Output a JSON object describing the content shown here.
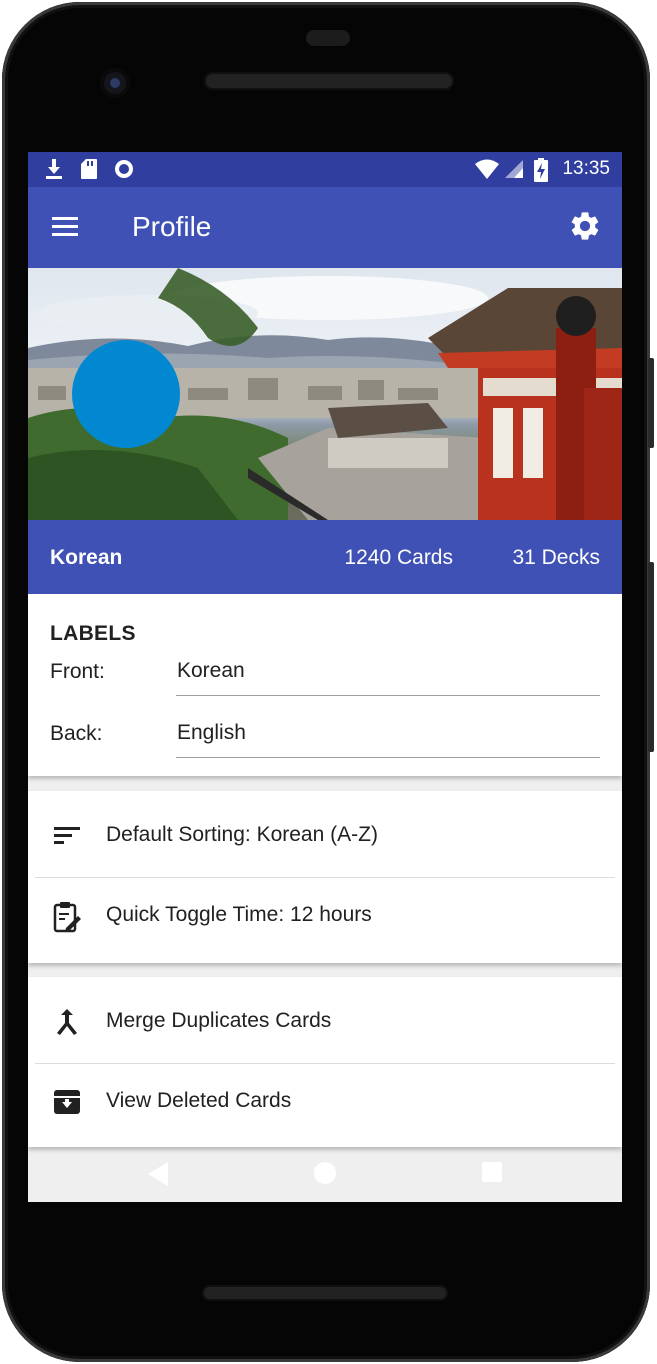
{
  "status_bar": {
    "time": "13:35",
    "left_icons": [
      "download-icon",
      "sd-card-icon",
      "record-icon"
    ],
    "right_icons": [
      "wifi-icon",
      "signal-icon",
      "battery-charging-icon"
    ]
  },
  "app_bar": {
    "title": "Profile",
    "menu_icon": "hamburger-menu-icon",
    "settings_icon": "gear-icon"
  },
  "profile": {
    "name": "Korean",
    "cards": "1240 Cards",
    "decks": "31 Decks",
    "avatar_color": "#0288d1"
  },
  "labels": {
    "heading": "LABELS",
    "front_label": "Front:",
    "front_value": "Korean",
    "back_label": "Back:",
    "back_value": "English"
  },
  "settings_list": [
    {
      "icon": "sort-icon",
      "label": "Default Sorting: Korean (A-Z)"
    },
    {
      "icon": "clipboard-edit-icon",
      "label": "Quick Toggle Time: 12 hours"
    }
  ],
  "tools_list": [
    {
      "icon": "merge-icon",
      "label": "Merge Duplicates Cards"
    },
    {
      "icon": "archive-icon",
      "label": "View Deleted Cards"
    }
  ],
  "nav_bar": [
    "back-triangle-icon",
    "home-circle-icon",
    "recents-square-icon"
  ],
  "colors": {
    "primary": "#3f51b5",
    "primary_dark": "#303f9f",
    "accent_avatar": "#0288d1"
  }
}
